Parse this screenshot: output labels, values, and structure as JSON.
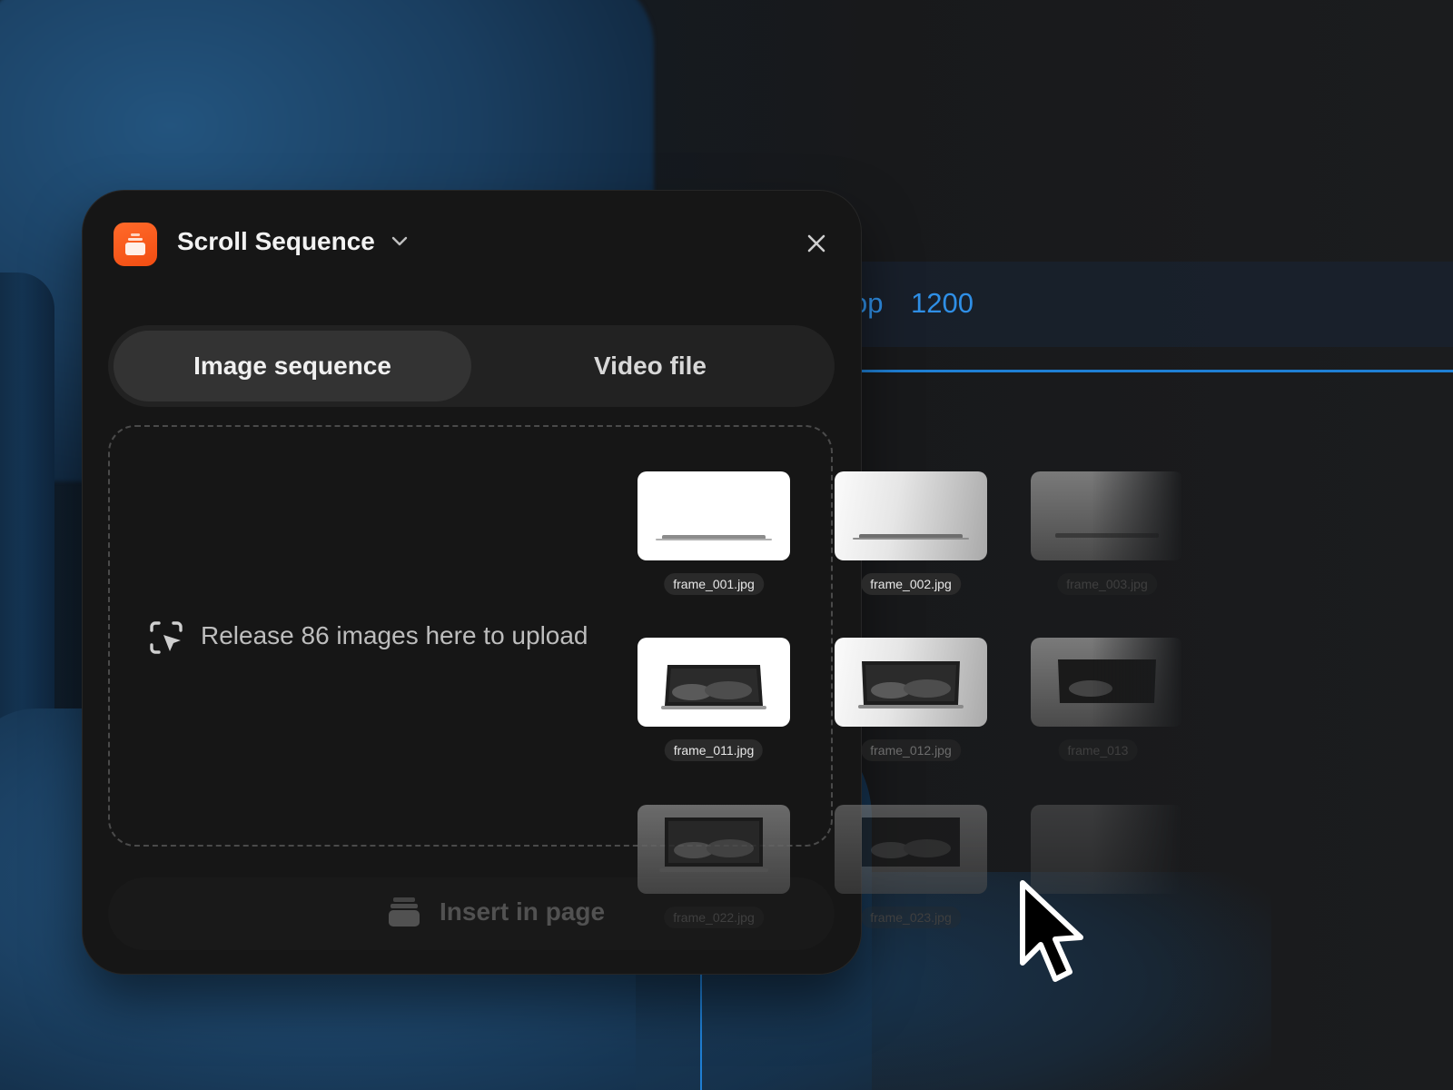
{
  "canvas": {
    "breadcrumb_fragment": "op",
    "width_value": "1200",
    "accent_color": "#2f8fe6"
  },
  "panel": {
    "title": "Scroll Sequence",
    "app_icon": "layers-icon",
    "brand_color": "#f24d12",
    "tabs": [
      {
        "label": "Image sequence",
        "active": true
      },
      {
        "label": "Video file",
        "active": false
      }
    ],
    "dropzone": {
      "message": "Release 86 images here to upload",
      "icon": "drop-select-icon"
    },
    "insert_button": {
      "label": "Insert in page",
      "icon": "stack-icon",
      "enabled": false
    }
  },
  "dragged_files": [
    "frame_001.jpg",
    "frame_002.jpg",
    "frame_003.jpg",
    "frame_011.jpg",
    "frame_012.jpg",
    "frame_013",
    "frame_022.jpg",
    "frame_023.jpg"
  ]
}
